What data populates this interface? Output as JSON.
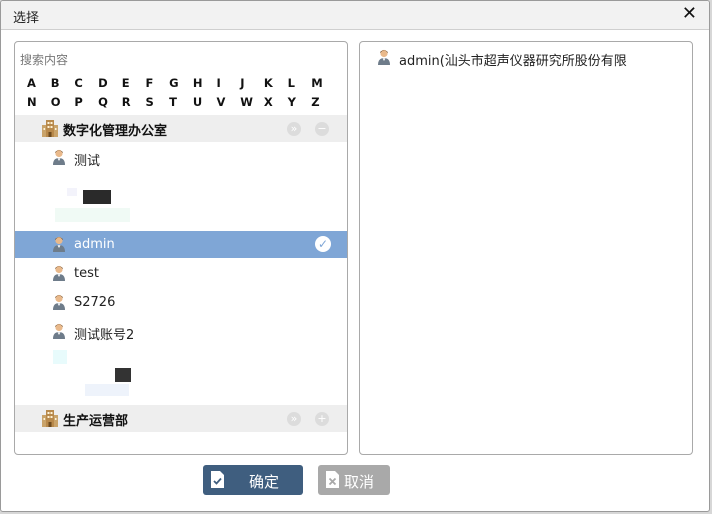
{
  "dialog": {
    "title": "选择",
    "close_symbol": "✕"
  },
  "search": {
    "placeholder": "搜索内容"
  },
  "alphabet": {
    "row1": [
      "A",
      "B",
      "C",
      "D",
      "E",
      "F",
      "G",
      "H",
      "I",
      "J",
      "K",
      "L",
      "M"
    ],
    "row2": [
      "N",
      "O",
      "P",
      "Q",
      "R",
      "S",
      "T",
      "U",
      "V",
      "W",
      "X",
      "Y",
      "Z"
    ]
  },
  "groups": [
    {
      "label": "数字化管理办公室"
    },
    {
      "label": "生产运营部"
    }
  ],
  "members": [
    {
      "label": "测试"
    },
    {
      "label": "admin",
      "selected": true
    },
    {
      "label": "test"
    },
    {
      "label": "S2726"
    },
    {
      "label": "测试账号2"
    }
  ],
  "selected_list": [
    {
      "label": "admin(汕头市超声仪器研究所股份有限"
    }
  ],
  "buttons": {
    "ok_label": "确定",
    "cancel_label": "取消"
  },
  "colors": {
    "selected_row": "#7fa6d6",
    "ok_button": "#3f5e7f",
    "cancel_button": "#a9a9a9"
  }
}
